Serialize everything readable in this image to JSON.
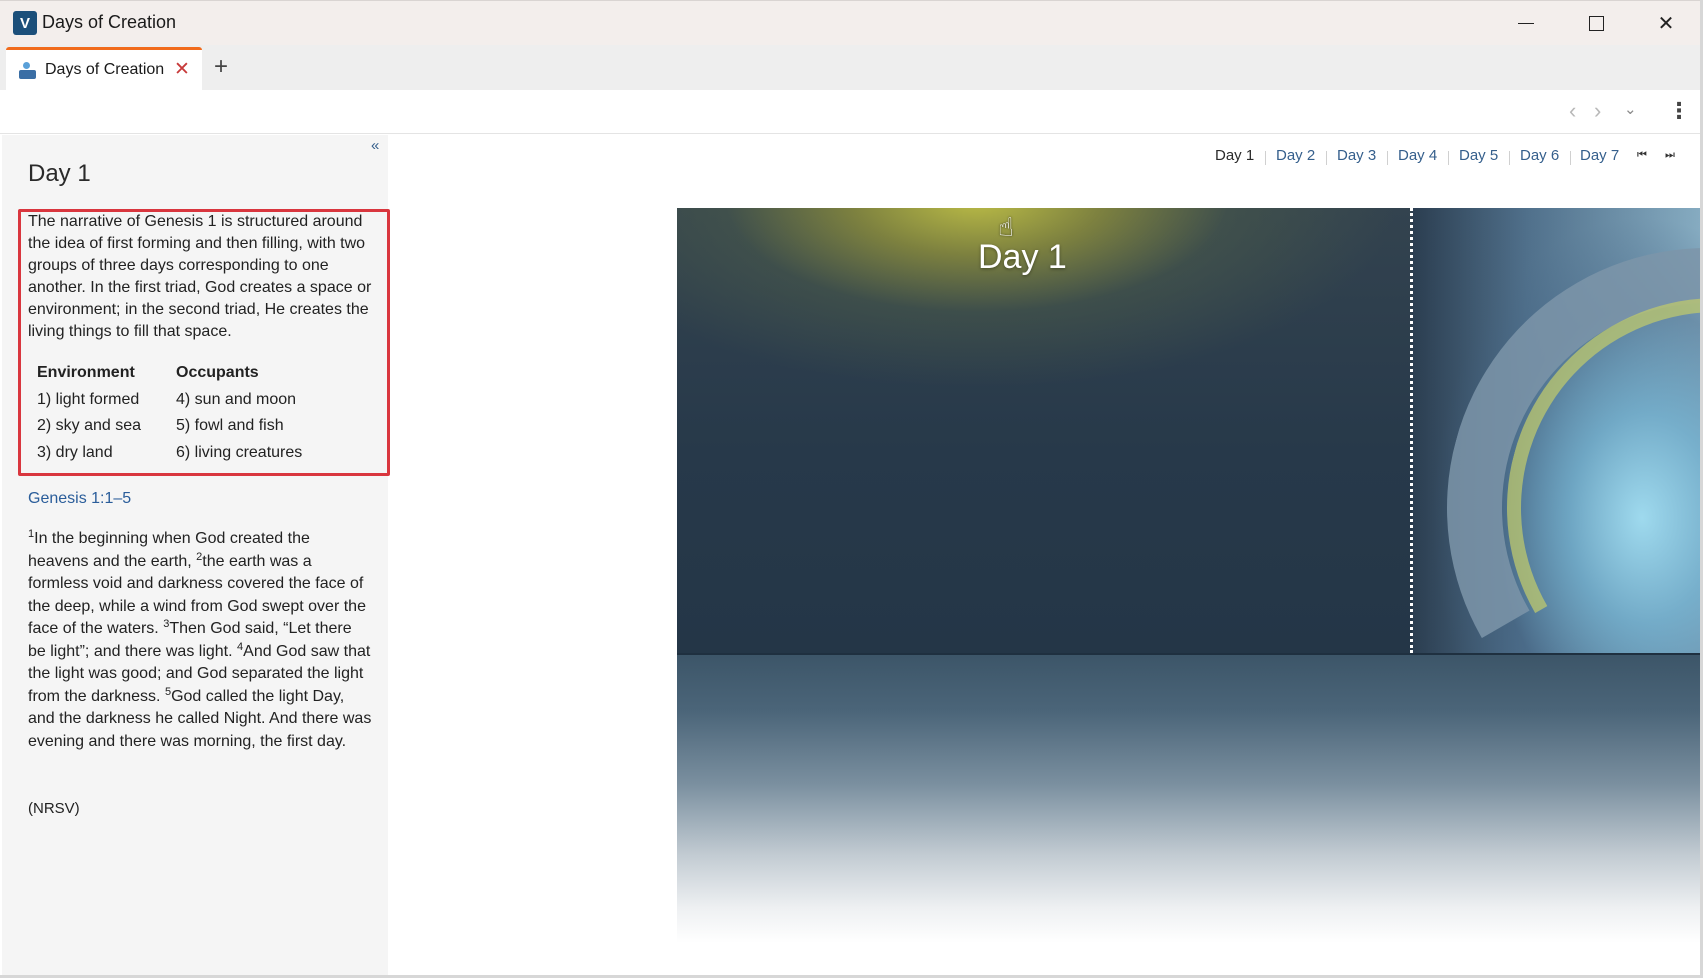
{
  "window": {
    "title": "Days of Creation",
    "app_icon": "logos-app-icon",
    "controls": [
      "minimize",
      "maximize",
      "close"
    ]
  },
  "tabs": [
    {
      "label": "Days of Creation",
      "active": true,
      "icon": "media-icon"
    }
  ],
  "toolbar": {
    "icons": [
      "chevron-left-icon",
      "chevron-right-icon",
      "chevron-down-icon",
      "more-vertical-icon"
    ]
  },
  "left_panel": {
    "collapse_label": "«",
    "heading": "Day 1",
    "intro": "The narrative of Genesis 1 is structured around the idea of first forming and then filling, with two groups of three days corresponding to one another. In the first triad, God creates a space or environment; in the second triad, He creates the living things to fill that space.",
    "table": {
      "headers": [
        "Environment",
        "Occupants"
      ],
      "environment": [
        "1) light formed",
        "2) sky and sea",
        "3) dry land"
      ],
      "occupants": [
        "4) sun and moon",
        "5) fowl and fish",
        "6) living creatures"
      ]
    },
    "passage_link": "Genesis 1:1–5",
    "scripture": [
      {
        "verse": "1",
        "text": "In the beginning when God created the heavens and the earth, "
      },
      {
        "verse": "2",
        "text": "the earth was a formless void and darkness covered the face of the deep, while a wind from God swept over the face of the waters. "
      },
      {
        "verse": "3",
        "text": "Then God said, “Let there be light”; and there was light. "
      },
      {
        "verse": "4",
        "text": "And God saw that the light was good; and God separated the light from the darkness. "
      },
      {
        "verse": "5",
        "text": "God called the light Day, and the darkness he called Night. And there was evening and there was morning, the first day."
      }
    ],
    "version": "(NRSV)"
  },
  "day_nav": {
    "items": [
      "Day 1",
      "Day 2",
      "Day 3",
      "Day 4",
      "Day 5",
      "Day 6",
      "Day 7"
    ],
    "current": "Day 1",
    "first_icon": "skip-first-icon",
    "last_icon": "skip-last-icon"
  },
  "illustration": {
    "title": "Day 1"
  },
  "colors": {
    "accent_tab": "#f16b1d",
    "link": "#2a5d9a",
    "highlight_border": "#d9363e"
  }
}
